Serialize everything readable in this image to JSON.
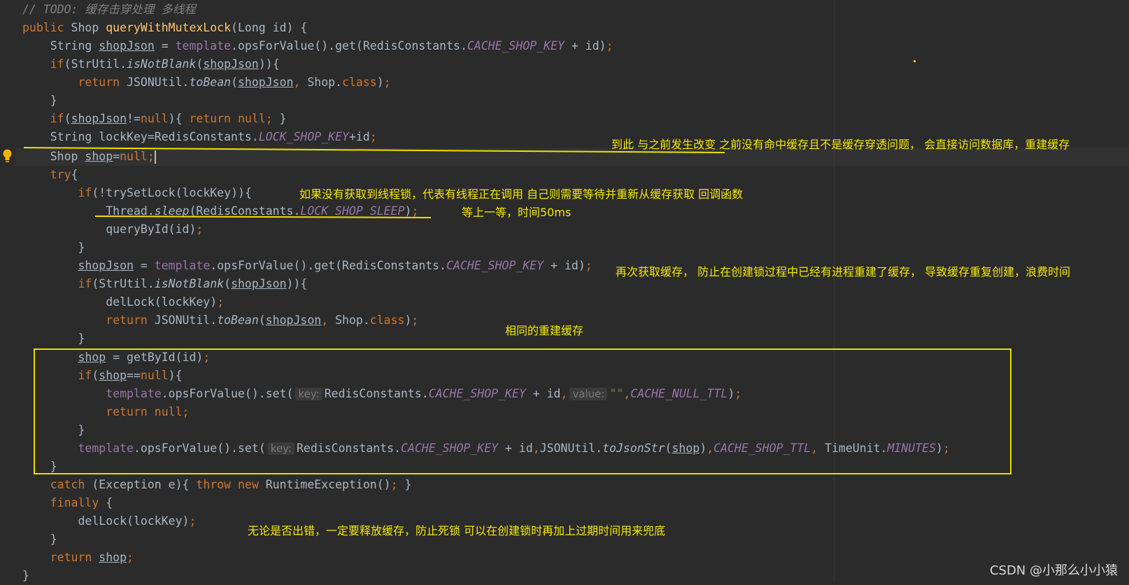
{
  "colors": {
    "background": "#2b2b2b",
    "keyword": "#cc7832",
    "method": "#ffc66d",
    "constant": "#9876aa",
    "text": "#a9b7c6",
    "annotation": "#f4e800"
  },
  "code": {
    "comment": "// TODO: 缓存击穿处理 多线程",
    "kw_public": "public",
    "kw_if": "if",
    "kw_return": "return",
    "kw_null": "null",
    "kw_try": "try",
    "kw_catch": "catch",
    "kw_throw": "throw",
    "kw_new": "new",
    "kw_finally": "finally",
    "kw_class": "class",
    "String": "String",
    "Shop": "Shop",
    "Long": "Long",
    "id": "id",
    "shopJson": "shopJson",
    "shop": "shop",
    "lockKey": "lockKey",
    "template": "template",
    "opsForValue": "opsForValue",
    "get": "get",
    "set": "set",
    "RedisConstants": "RedisConstants",
    "StrUtil": "StrUtil",
    "JSONUtil": "JSONUtil",
    "Thread": "Thread",
    "TimeUnit": "TimeUnit",
    "Exception": "Exception",
    "e": "e",
    "RuntimeException": "RuntimeException",
    "queryWithMutexLock": "queryWithMutexLock",
    "isNotBlank": "isNotBlank",
    "toBean": "toBean",
    "trySetLock": "trySetLock",
    "sleep": "sleep",
    "queryById": "queryById",
    "delLock": "delLock",
    "getById": "getById",
    "toJsonStr": "toJsonStr",
    "CACHE_SHOP_KEY": "CACHE_SHOP_KEY",
    "LOCK_SHOP_KEY": "LOCK_SHOP_KEY",
    "LOCK_SHOP_SLEEP": "LOCK_SHOP_SLEEP",
    "CACHE_NULL_TTL": "CACHE_NULL_TTL",
    "CACHE_SHOP_TTL": "CACHE_SHOP_TTL",
    "MINUTES": "MINUTES",
    "hint_key": "key:",
    "hint_value": "value:",
    "empty_str": "\"\"",
    "b_open": "{",
    "b_close": "}"
  },
  "annotations": {
    "a1": "到此 与之前发生改变 之前没有命中缓存且不是缓存穿透问题， 会直接访问数据库，重建缓存",
    "a2": "如果没有获取到线程锁，代表有线程正在调用 自己则需要等待并重新从缓存获取  回调函数",
    "a3": "等上一等，时间50ms",
    "a4": "再次获取缓存， 防止在创建锁过程中已经有进程重建了缓存， 导致缓存重复创建，浪费时间",
    "a5": "相同的重建缓存",
    "a6": "无论是否出错，一定要释放缓存，防止死锁  可以在创建锁时再加上过期时间用来兜底"
  },
  "icons": {
    "gutter": "lightbulb-icon"
  },
  "watermark": "CSDN @小那么小小猿"
}
